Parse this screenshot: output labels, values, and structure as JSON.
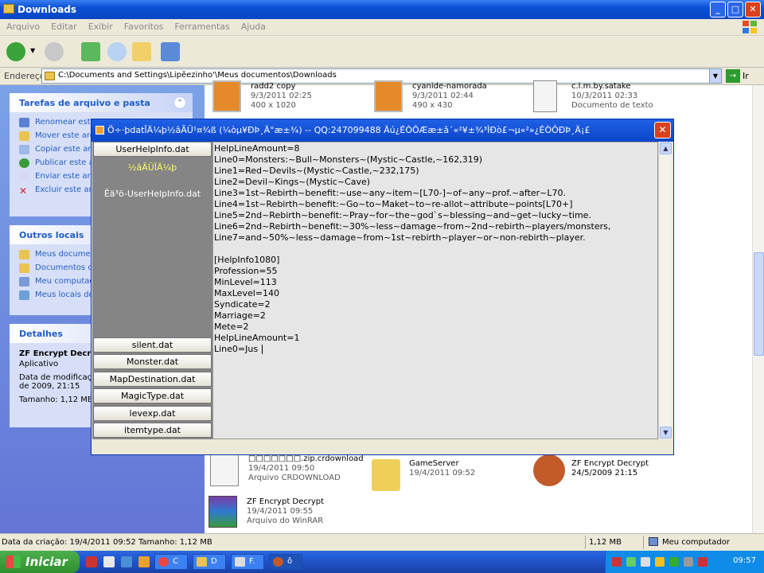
{
  "window": {
    "title": "Downloads",
    "title_icon": "folder-icon"
  },
  "menu": [
    "Arquivo",
    "Editar",
    "Exibir",
    "Favoritos",
    "Ferramentas",
    "Ajuda"
  ],
  "address": {
    "label": "Endereço",
    "path": "C:\\Documents and Settings\\Lipêezinho'\\Meus documentos\\Downloads",
    "go_label": "Ir"
  },
  "sidebar": {
    "tasks": {
      "title": "Tarefas de arquivo e pasta",
      "items": [
        "Renomear este",
        "Mover este arq",
        "Copiar este arq",
        "Publicar este a",
        "Enviar este arq",
        "Excluir este arq"
      ]
    },
    "places": {
      "title": "Outros locais",
      "items": [
        "Meus documen",
        "Documentos co",
        "Meu computado",
        "Meus locais de"
      ]
    },
    "details": {
      "title": "Detalhes",
      "name": "ZF Encrypt Decry",
      "type": "Aplicativo",
      "modified": "Data de modificaçã",
      "modified2": "de 2009, 21:15",
      "size": "Tamanho: 1,12 MB"
    }
  },
  "files_top": [
    {
      "name": "radd2 copy",
      "line2": "9/3/2011 02:25",
      "line3": "400 x 1020"
    },
    {
      "name": "cyanide-namorada",
      "line2": "9/3/2011 02:44",
      "line3": "490 x 430"
    },
    {
      "name": "c.l.m.by.satake",
      "line2": "10/3/2011 02:33",
      "line3": "Documento de texto"
    }
  ],
  "files_bottom": [
    {
      "name": "□□□□□□□.zip.crdownload",
      "line2": "19/4/2011 09:50",
      "line3": "Arquivo CRDOWNLOAD"
    },
    {
      "name": "GameServer",
      "line2": "19/4/2011 09:52",
      "line3": ""
    },
    {
      "name": "ZF Encrypt Decrypt",
      "line2": "24/5/2009 21:15",
      "line3": ""
    },
    {
      "name": "ZF Encrypt Decrypt",
      "line2": "19/4/2011 09:55",
      "line3": "Arquivo do WinRAR"
    }
  ],
  "dialog": {
    "title": "Ö÷·þdatÎÄ¼þ½âÃÜ¹¤¾ß (¼òµ¥ÐÞ¸Ä°æ±¾)  --   QQ:247099488   Äú¿ÉÒÔÆæ±â´«²¥±¾³ÌÐò£¬µ«²»¿ÉÒÔÐÞ¸Ä¡£",
    "file_top": "UserHelpInfo.dat",
    "label_a": "½âÃÜÎÄ¼þ",
    "label_b": "Êä³ö-UserHelpInfo.dat",
    "file_buttons": [
      "silent.dat",
      "Monster.dat",
      "MapDestination.dat",
      "MagicType.dat",
      "levexp.dat",
      "itemtype.dat"
    ],
    "lines": [
      "HelpLineAmount=8",
      "Line0=Monsters:~Bull~Monsters~(Mystic~Castle,~162,319)",
      "Line1=Red~Devils~(Mystic~Castle,~232,175)",
      "Line2=Devil~Kings~(Mystic~Cave)",
      "Line3=1st~Rebirth~benefit:~use~any~item~[L70-]~of~any~prof.~after~L70.",
      "Line4=1st~Rebirth~benefit:~Go~to~Maket~to~re-allot~attribute~points[L70+]",
      "Line5=2nd~Rebirth~benefit:~Pray~for~the~god`s~blessing~and~get~lucky~time.",
      "Line6=2nd~Rebirth~benefit:~30%~less~damage~from~2nd~rebirth~players/monsters,",
      "Line7=and~50%~less~damage~from~1st~rebirth~player~or~non-rebirth~player.",
      "",
      "[HelpInfo1080]",
      "Profession=55",
      "MinLevel=113",
      "MaxLevel=140",
      "Syndicate=2",
      "Marriage=2",
      "Mete=2",
      "HelpLineAmount=1"
    ],
    "last_line": "Line0=Jus"
  },
  "status": {
    "left": "Data da criação: 19/4/2011 09:52 Tamanho: 1,12 MB",
    "size": "1,12 MB",
    "computer": "Meu computador"
  },
  "taskbar": {
    "start": "Iniciar",
    "tasks": [
      "C",
      "D",
      "F.",
      "ô"
    ],
    "clock": "09:57"
  }
}
